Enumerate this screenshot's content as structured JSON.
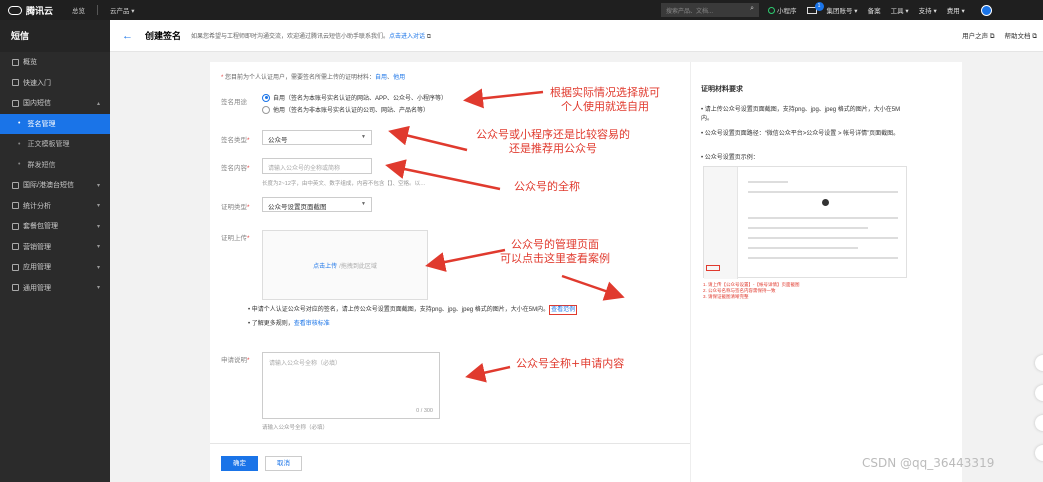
{
  "topbar": {
    "brand": "腾讯云",
    "nav": [
      "总览",
      "云产品"
    ],
    "search_placeholder": "搜索产品、文档...",
    "mini_program": "小程序",
    "mail_badge": "1",
    "menu": [
      "集团账号",
      "备案",
      "工具",
      "支持",
      "费用"
    ]
  },
  "sidebar": {
    "title": "短信",
    "items": [
      {
        "label": "概览"
      },
      {
        "label": "快速入门"
      },
      {
        "label": "国内短信"
      },
      {
        "label": "签名管理"
      },
      {
        "label": "正文模板管理"
      },
      {
        "label": "群发短信"
      },
      {
        "label": "国际/港澳台短信"
      },
      {
        "label": "统计分析"
      },
      {
        "label": "套餐包管理"
      },
      {
        "label": "营销管理"
      },
      {
        "label": "应用管理"
      },
      {
        "label": "通用管理"
      }
    ]
  },
  "header": {
    "title": "创建签名",
    "notice": "如果您希望与工程师即时沟通交流，欢迎通过腾讯云短信小助手联系我们。",
    "notice_link": "点击进入对话",
    "right": [
      "用户之声",
      "帮助文档"
    ]
  },
  "form": {
    "note": "您目前为个人认证用户，需要签名所需上传的证明材料：",
    "note_link1": "自用",
    "note_link2": "他用",
    "purpose_label": "签名用途",
    "purpose_self": "自用（签名为本账号实名认证的网站、APP、公众号、小程序等）",
    "purpose_other": "他用（签名为非本账号实名认证的公司、网站、产品名等）",
    "type_label": "签名类型",
    "type_value": "公众号",
    "content_label": "签名内容",
    "content_placeholder": "请输入公众号的全称或简称",
    "content_hint": "长度为2~12字，由中英文、数字组成，内容不包含【】、空格。以…",
    "proof_type_label": "证明类型",
    "proof_type_value": "公众号设置页面截图",
    "proof_upload_label": "证明上传",
    "upload_link": "点击上传",
    "upload_text": "/拖拽到此区域",
    "bullet1": "申请个人认证公众号对应的签名，请上传公众号设置页面截图，支持png、jpg、jpeg 格式的图片，大小在5M内。",
    "bullet1_link": "查看范例",
    "bullet2": "了解更多规则，",
    "bullet2_link": "查看审核标准",
    "apply_label": "申请说明",
    "apply_placeholder": "请输入公众号全称（必填）",
    "apply_count": "0 / 300",
    "apply_hint": "请输入公众号全称（必填）",
    "ok": "确定",
    "cancel": "取消"
  },
  "right_panel": {
    "title": "证明材料要求",
    "items": [
      "请上传公众号设置页面截图，支持png、jpg、jpeg 格式的图片，大小在5M内。",
      "公众号设置页面路径：“微信公众平台>公众号设置 > 帐号详情”页面截图。",
      "公众号设置页示例："
    ],
    "red_lines": [
      "1. 请上传【公众号设置】-【帐号详情】页面截图",
      "2. 公众号名称与签名内容需保持一致",
      "3. 请保证截图清晰完整"
    ]
  },
  "annotations": {
    "a1": "根据实际情况选择就可\n个人使用就选自用",
    "a2": "公众号或小程序还是比较容易的\n还是推荐用公众号",
    "a3": "公众号的全称",
    "a4": "公众号的管理页面\n可以点击这里查看案例",
    "a5": "公众号全称+申请内容"
  },
  "watermark": "CSDN @qq_36443319",
  "colors": {
    "accent": "#1a74e8",
    "annotation": "#e03a2e",
    "sidebar": "#2b2b2b"
  }
}
